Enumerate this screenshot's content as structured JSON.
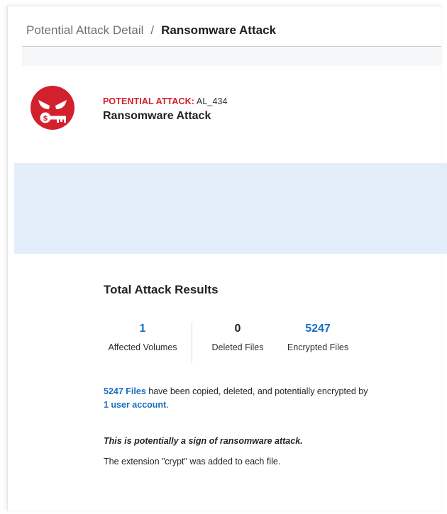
{
  "breadcrumb": {
    "parent": "Potential Attack Detail",
    "separator": "/",
    "current": "Ransomware Attack"
  },
  "attack": {
    "icon": "angry-face-key-icon",
    "label": "POTENTIAL ATTACK:",
    "code": "AL_434",
    "title": "Ransomware Attack"
  },
  "results": {
    "title": "Total Attack Results",
    "stats": [
      {
        "value": "1",
        "caption": "Affected Volumes"
      },
      {
        "value": "0",
        "caption": "Deleted Files"
      },
      {
        "value": "5247",
        "caption": "Encrypted Files"
      }
    ],
    "summary": {
      "files_link": "5247 Files",
      "middle": " have been copied, deleted, and potentially encrypted by ",
      "user_link": "1 user account",
      "end": "."
    },
    "warning": "This is potentially a sign of ransomware attack.",
    "extension_note": "The extension \"crypt\" was added to each file."
  },
  "colors": {
    "accent_red": "#d3202d",
    "link_blue": "#1a6ec0",
    "info_band": "#e3eefa"
  }
}
